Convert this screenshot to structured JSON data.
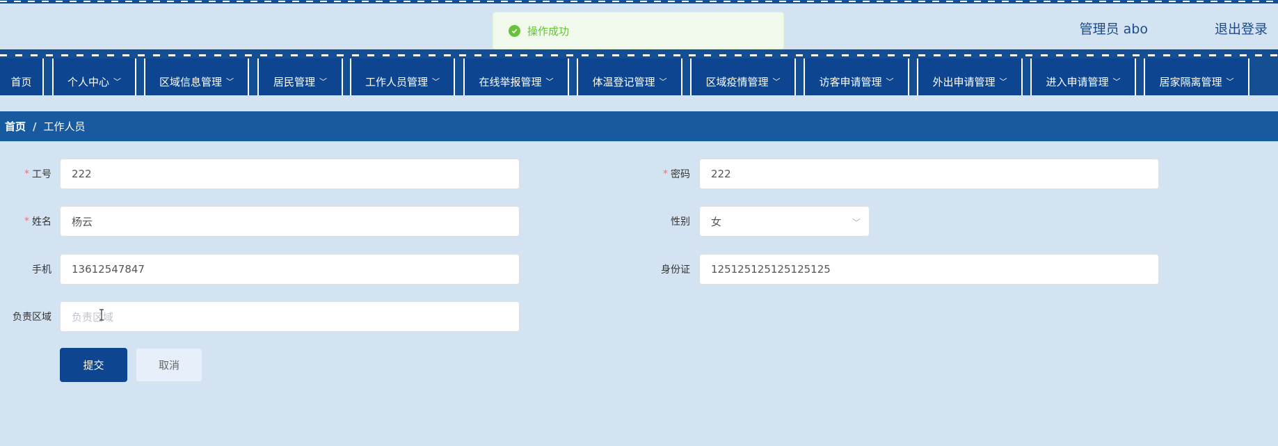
{
  "toast": {
    "message": "操作成功",
    "icon": "check-circle-icon"
  },
  "header": {
    "user": "管理员 abo",
    "logout": "退出登录"
  },
  "nav": {
    "items": [
      {
        "label": "首页",
        "has_dropdown": false
      },
      {
        "label": "个人中心",
        "has_dropdown": true
      },
      {
        "label": "区域信息管理",
        "has_dropdown": true
      },
      {
        "label": "居民管理",
        "has_dropdown": true
      },
      {
        "label": "工作人员管理",
        "has_dropdown": true
      },
      {
        "label": "在线举报管理",
        "has_dropdown": true
      },
      {
        "label": "体温登记管理",
        "has_dropdown": true
      },
      {
        "label": "区域疫情管理",
        "has_dropdown": true
      },
      {
        "label": "访客申请管理",
        "has_dropdown": true
      },
      {
        "label": "外出申请管理",
        "has_dropdown": true
      },
      {
        "label": "进入申请管理",
        "has_dropdown": true
      },
      {
        "label": "居家隔离管理",
        "has_dropdown": true
      }
    ]
  },
  "breadcrumb": {
    "home": "首页",
    "separator": "/",
    "current": "工作人员"
  },
  "form": {
    "gonghao": {
      "label": "工号",
      "value": "222",
      "required": true
    },
    "mima": {
      "label": "密码",
      "value": "222",
      "required": true
    },
    "xingming": {
      "label": "姓名",
      "value": "杨云",
      "required": true
    },
    "xingbie": {
      "label": "性别",
      "value": "女"
    },
    "shouji": {
      "label": "手机",
      "value": "13612547847"
    },
    "shenfenzheng": {
      "label": "身份证",
      "value": "125125125125125125"
    },
    "quyu": {
      "label": "负责区域",
      "placeholder": "负责区域"
    },
    "submit": "提交",
    "cancel": "取消"
  },
  "colors": {
    "primary": "#0d4590",
    "nav_bg": "#144f94",
    "breadcrumb_bg": "#175aa0",
    "page_bg": "#d3e3f2",
    "success": "#67c23a"
  }
}
